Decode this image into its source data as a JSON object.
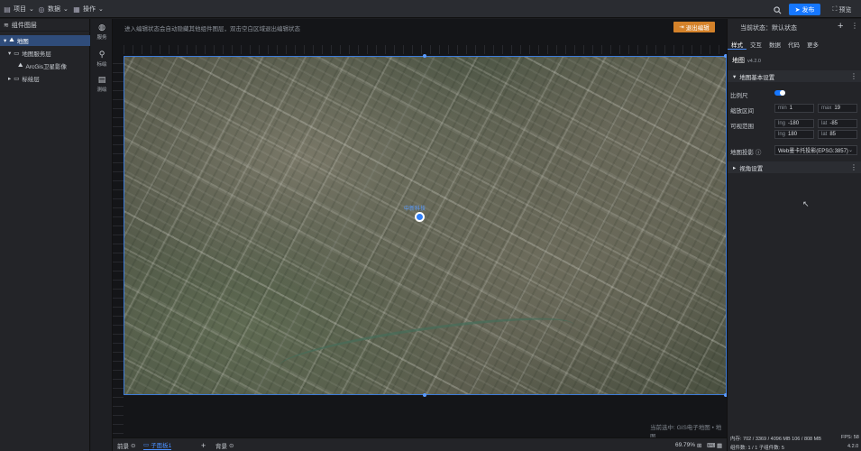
{
  "topbar": {
    "items": [
      {
        "label": "项目",
        "icon": "layers-icon"
      },
      {
        "label": "数据",
        "icon": "database-icon"
      },
      {
        "label": "操作",
        "icon": "grid-icon"
      }
    ],
    "publish_label": "发布",
    "preview_label": "预览"
  },
  "layers": {
    "title": "组件图层",
    "rows": [
      {
        "label": "地图",
        "selected": true
      },
      {
        "label": "地图服务层",
        "selected": false
      },
      {
        "label": "ArcGis卫星影像",
        "selected": false
      },
      {
        "label": "标绘层",
        "selected": false
      }
    ]
  },
  "iconbar": {
    "items": [
      {
        "label": "服务",
        "icon": "globe-icon"
      },
      {
        "label": "标绘",
        "icon": "pin-icon"
      },
      {
        "label": "测绘",
        "icon": "ruler-icon"
      }
    ]
  },
  "canvas": {
    "hint": "进入编辑状态会自动隐藏其他组件图层，双击空白区域退出编辑状态",
    "exit_label": "退出编辑",
    "marker_label": "中新科技",
    "bottom_text": "当前选中: GIS电子地图 • 地图"
  },
  "bottombar": {
    "tabs": [
      {
        "label": "前景",
        "active": false
      },
      {
        "label": "子面板1",
        "active": true
      },
      {
        "label": "背景",
        "active": false
      }
    ],
    "add_label": "+",
    "zoom": "69.79%"
  },
  "right": {
    "state_label": "当前状态：默认状态",
    "tabs": [
      "样式",
      "交互",
      "数据",
      "代码",
      "更多"
    ],
    "active_tab": "样式",
    "component_name": "地图",
    "component_version": "v4.2.0",
    "section_basic": "地图基本设置",
    "scale_label": "比例尺",
    "scale_on": true,
    "zoom_range_label": "缩放区间",
    "zoom_min_prefix": "min",
    "zoom_min": "1",
    "zoom_max_prefix": "max",
    "zoom_max": "19",
    "visible_range_label": "可视范围",
    "lng_prefix": "lng",
    "lat_prefix": "lat",
    "lng_min": "-180",
    "lat_min": "-85",
    "lng_max": "180",
    "lat_max": "85",
    "projection_label": "地图投影",
    "projection_value": "Web墨卡托投影(EPSG:3857)",
    "section_view": "视角设置"
  },
  "status": {
    "memory": "内存: 702 / 3369 / 4096 MB  106 / 808 MB",
    "components": "组件数: 1 / 1   子组件数: 5",
    "fps": "FPS: 58",
    "version": "4.2.0"
  },
  "colors": {
    "accent": "#1677ff",
    "exit_button": "#d4822a",
    "selected_row": "#2f4c7a"
  }
}
